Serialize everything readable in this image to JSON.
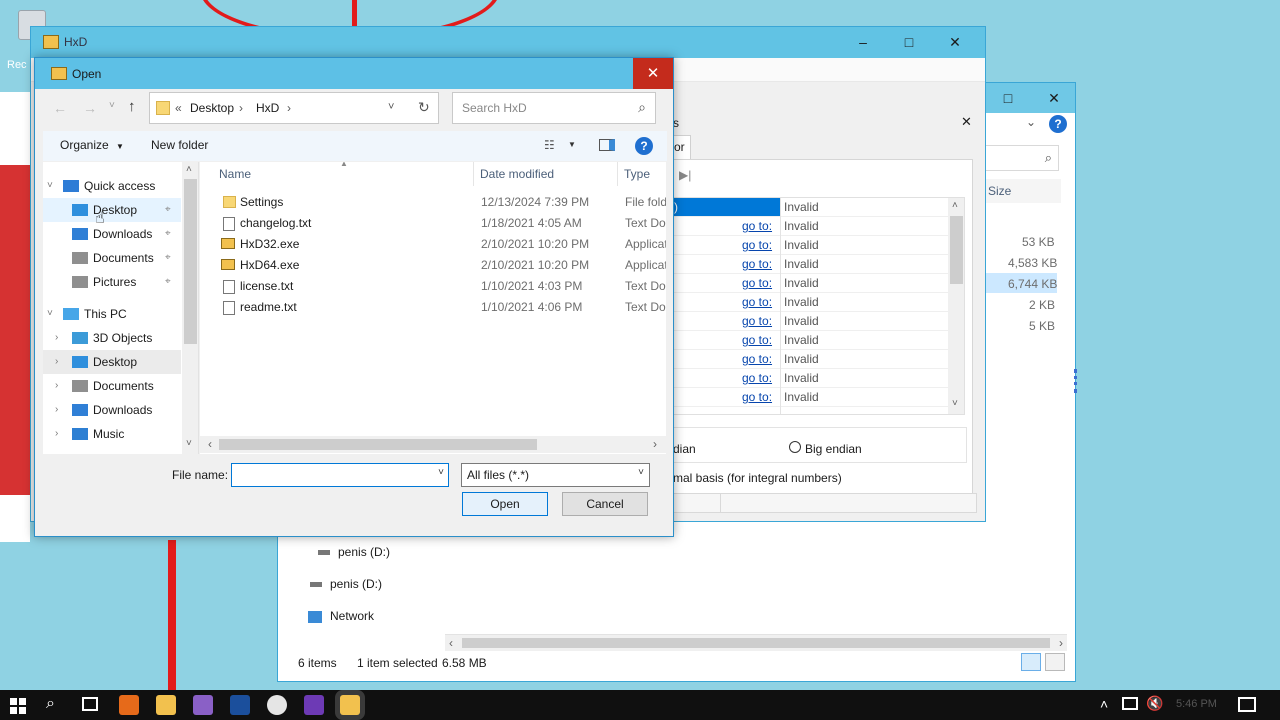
{
  "desktop": {
    "recycle_label": "Rec"
  },
  "explorer": {
    "status_items": "6 items",
    "status_selected": "1 item selected",
    "status_size": "6.58 MB",
    "size_header": "Size",
    "sizes": [
      "53 KB",
      "4,583 KB",
      "6,744 KB",
      "2 KB",
      "5 KB"
    ],
    "nav": [
      {
        "label": "penis (D:)"
      },
      {
        "label": "penis (D:)"
      },
      {
        "label": "Network"
      }
    ]
  },
  "hxd": {
    "title": "HxD",
    "tab_fragment": "or",
    "tab_fragment2": "s",
    "rows": [
      {
        "goto": ")",
        "value": "Invalid"
      },
      {
        "goto": "go to:",
        "value": "Invalid"
      },
      {
        "goto": "go to:",
        "value": "Invalid"
      },
      {
        "goto": "go to:",
        "value": "Invalid"
      },
      {
        "goto": "go to:",
        "value": "Invalid"
      },
      {
        "goto": "go to:",
        "value": "Invalid"
      },
      {
        "goto": "go to:",
        "value": "Invalid"
      },
      {
        "goto": "go to:",
        "value": "Invalid"
      },
      {
        "goto": "go to:",
        "value": "Invalid"
      },
      {
        "goto": "go to:",
        "value": "Invalid"
      },
      {
        "goto": "go to:",
        "value": "Invalid"
      }
    ],
    "endian_little_fragment": "dian",
    "endian_big": "Big endian",
    "basis_fragment": "mal basis (for integral numbers)"
  },
  "dialog": {
    "title": "Open",
    "breadcrumb": [
      "Desktop",
      "HxD"
    ],
    "breadcrumb_prefix": "«",
    "search_placeholder": "Search HxD",
    "organize": "Organize",
    "new_folder": "New folder",
    "columns": {
      "name": "Name",
      "date": "Date modified",
      "type": "Type"
    },
    "tree": [
      {
        "label": "Quick access",
        "icon": "star-icon",
        "level": 0,
        "expander": "open"
      },
      {
        "label": "Desktop",
        "icon": "desktop-icon",
        "level": 1,
        "pinned": true,
        "selected": true
      },
      {
        "label": "Downloads",
        "icon": "download-icon",
        "level": 1,
        "pinned": true
      },
      {
        "label": "Documents",
        "icon": "documents-icon",
        "level": 1,
        "pinned": true
      },
      {
        "label": "Pictures",
        "icon": "pictures-icon",
        "level": 1,
        "pinned": true
      },
      {
        "label": "This PC",
        "icon": "computer-icon",
        "level": 0,
        "expander": "open"
      },
      {
        "label": "3D Objects",
        "icon": "cube-icon",
        "level": 1,
        "expander": "closed"
      },
      {
        "label": "Desktop",
        "icon": "desktop-icon",
        "level": 1,
        "expander": "closed",
        "highlight": true
      },
      {
        "label": "Documents",
        "icon": "documents-icon",
        "level": 1,
        "expander": "closed"
      },
      {
        "label": "Downloads",
        "icon": "download-icon",
        "level": 1,
        "expander": "closed"
      },
      {
        "label": "Music",
        "icon": "music-icon",
        "level": 1,
        "expander": "closed"
      }
    ],
    "files": [
      {
        "name": "Settings",
        "date": "12/13/2024 7:39 PM",
        "type": "File fold",
        "icon": "folder-icon"
      },
      {
        "name": "changelog.txt",
        "date": "1/18/2021 4:05 AM",
        "type": "Text Doc",
        "icon": "text-file-icon"
      },
      {
        "name": "HxD32.exe",
        "date": "2/10/2021 10:20 PM",
        "type": "Applicat",
        "icon": "hxd-exe-icon"
      },
      {
        "name": "HxD64.exe",
        "date": "2/10/2021 10:20 PM",
        "type": "Applicat",
        "icon": "hxd-exe-icon"
      },
      {
        "name": "license.txt",
        "date": "1/10/2021 4:03 PM",
        "type": "Text Doc",
        "icon": "text-file-icon"
      },
      {
        "name": "readme.txt",
        "date": "1/10/2021 4:06 PM",
        "type": "Text Doc",
        "icon": "text-file-icon"
      }
    ],
    "filename_label": "File name:",
    "filename_value": "",
    "filter": "All files (*.*)",
    "open_button": "Open",
    "cancel_button": "Cancel"
  },
  "taskbar": {
    "clock": "5:46 PM"
  },
  "colors": {
    "accent": "#0078d7",
    "title_active": "#5dc0e6",
    "close_red": "#c42b1c",
    "selection": "#0078d7",
    "annotation_red": "#e21b1b"
  }
}
